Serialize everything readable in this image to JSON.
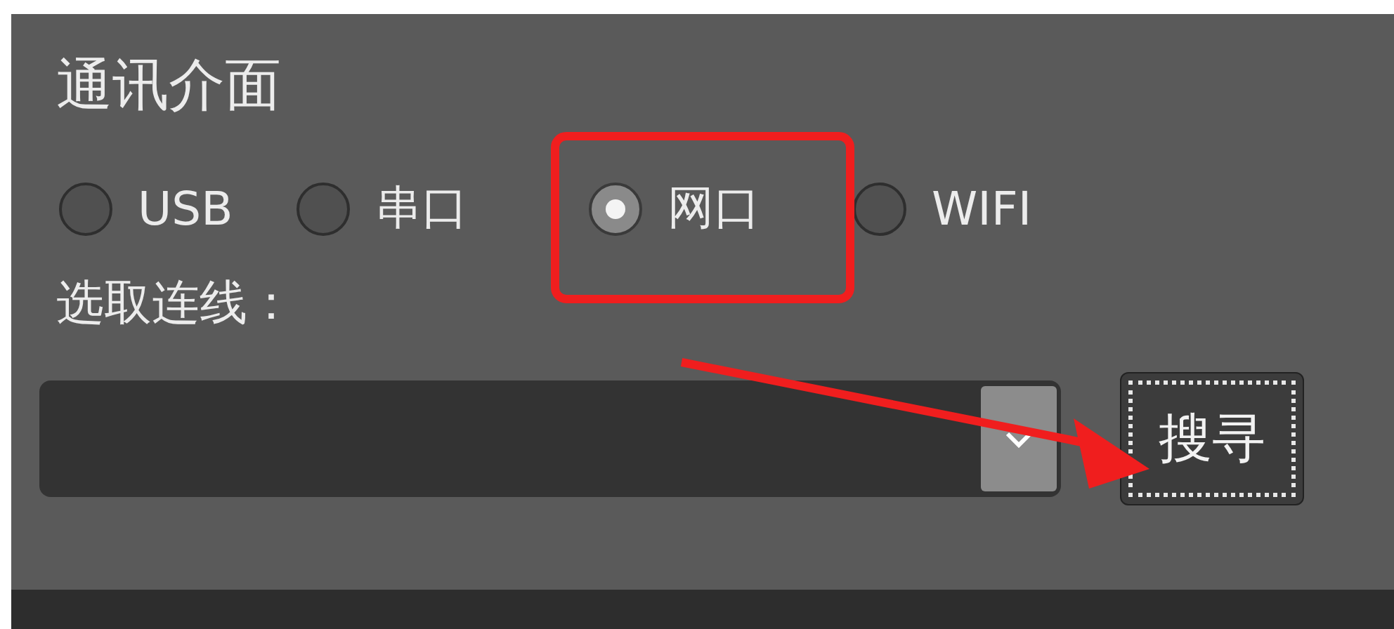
{
  "panel": {
    "title": "通讯介面"
  },
  "interfaces": [
    {
      "label": "USB",
      "selected": false
    },
    {
      "label": "串口",
      "selected": false
    },
    {
      "label": "网口",
      "selected": true
    },
    {
      "label": "WIFI",
      "selected": false
    }
  ],
  "connection": {
    "label": "选取连线：",
    "search_button": "搜寻"
  },
  "annotations": {
    "highlight_box": true,
    "arrow": true
  }
}
